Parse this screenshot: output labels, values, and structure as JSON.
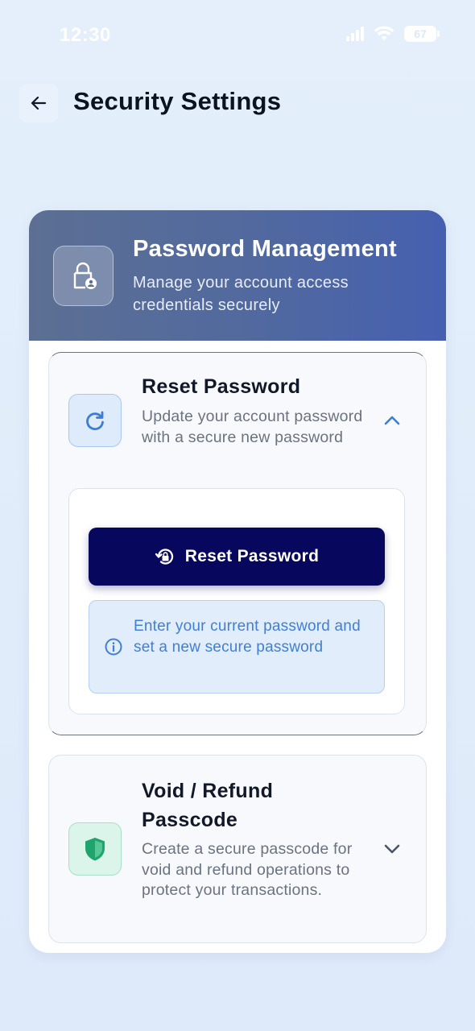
{
  "status_bar": {
    "time": "12:30",
    "battery": "67"
  },
  "header": {
    "title": "Security Settings"
  },
  "card": {
    "title": "Password Management",
    "subtitle": "Manage your account access credentials securely"
  },
  "reset_section": {
    "title": "Reset Password",
    "description": "Update your account password with a secure new password",
    "expanded": true,
    "button_label": "Reset Password",
    "info_text": "Enter your current password and set a new secure password"
  },
  "void_section": {
    "title_line1": "Void / Refund",
    "title_line2": "Passcode",
    "description": "Create a secure passcode for void and refund operations to protect your transactions.",
    "expanded": false
  },
  "colors": {
    "background": "#e3effb",
    "header_gradient_start": "#5c6f93",
    "header_gradient_end": "#4660b0",
    "primary_button": "#07075e",
    "info_text": "#3f7fd6",
    "green_accent": "#1fa46d"
  },
  "icons": {
    "back": "arrow-left-icon",
    "header": "lock-user-icon",
    "reset": "refresh-icon",
    "button": "lock-reset-icon",
    "info": "info-icon",
    "void": "shield-icon",
    "expand_open": "chevron-up-icon",
    "expand_closed": "chevron-down-icon"
  }
}
